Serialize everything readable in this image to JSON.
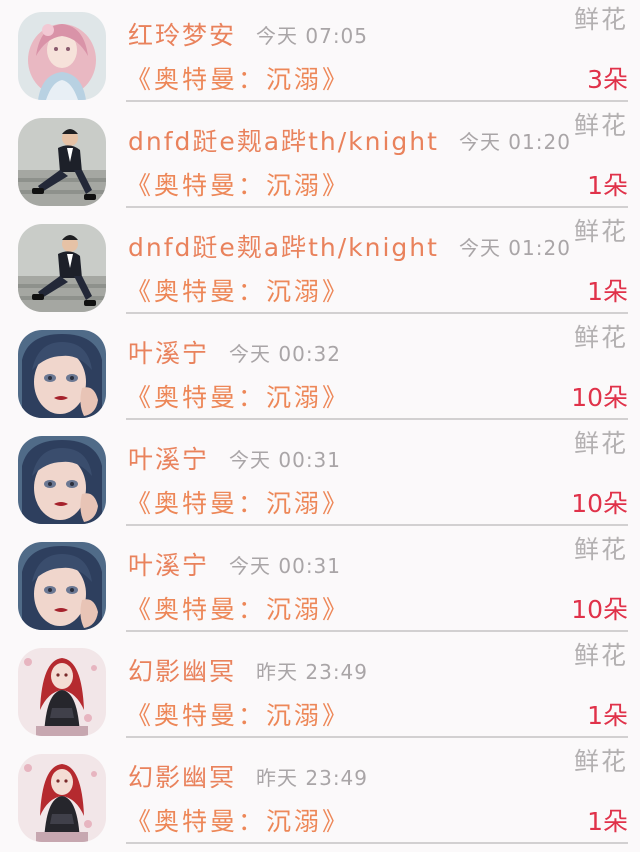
{
  "records": [
    {
      "avatar": "avatar-anime-girl-pink",
      "name": "红玲梦安",
      "time": "今天 07:05",
      "gift": "鲜花",
      "book": "《奥特曼：沉溺》",
      "count": "3朵"
    },
    {
      "avatar": "avatar-man-suit",
      "name": "dnfd跹e觌a跸th/knight",
      "time": "今天 01:20",
      "gift": "鲜花",
      "book": "《奥特曼：沉溺》",
      "count": "1朵"
    },
    {
      "avatar": "avatar-man-suit",
      "name": "dnfd跹e觌a跸th/knight",
      "time": "今天 01:20",
      "gift": "鲜花",
      "book": "《奥特曼：沉溺》",
      "count": "1朵"
    },
    {
      "avatar": "avatar-girl-blue-hair",
      "name": "叶溪宁",
      "time": "今天 00:32",
      "gift": "鲜花",
      "book": "《奥特曼：沉溺》",
      "count": "10朵"
    },
    {
      "avatar": "avatar-girl-blue-hair",
      "name": "叶溪宁",
      "time": "今天 00:31",
      "gift": "鲜花",
      "book": "《奥特曼：沉溺》",
      "count": "10朵"
    },
    {
      "avatar": "avatar-girl-blue-hair",
      "name": "叶溪宁",
      "time": "今天 00:31",
      "gift": "鲜花",
      "book": "《奥特曼：沉溺》",
      "count": "10朵"
    },
    {
      "avatar": "avatar-girl-red-hair",
      "name": "幻影幽冥",
      "time": "昨天 23:49",
      "gift": "鲜花",
      "book": "《奥特曼：沉溺》",
      "count": "1朵"
    },
    {
      "avatar": "avatar-girl-red-hair",
      "name": "幻影幽冥",
      "time": "昨天 23:49",
      "gift": "鲜花",
      "book": "《奥特曼：沉溺》",
      "count": "1朵"
    }
  ]
}
